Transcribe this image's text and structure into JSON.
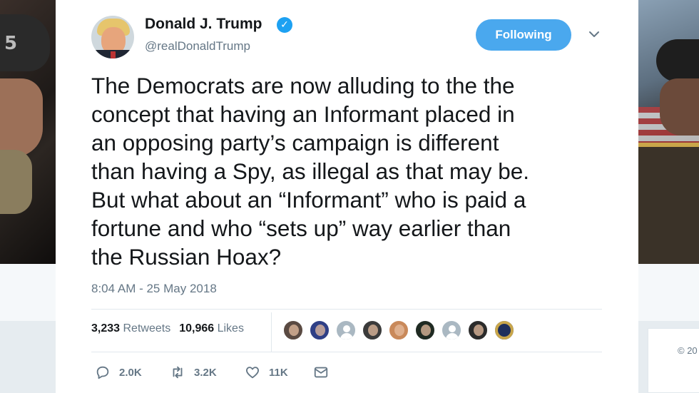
{
  "background": {
    "helmet_number": "5",
    "copyright_fragment": "© 20"
  },
  "tweet": {
    "author_name": "Donald J. Trump",
    "verified_mark": "✓",
    "handle": "@realDonaldTrump",
    "follow_button_label": "Following",
    "menu_icon": "chevron-down-icon",
    "text_lines": [
      "The Democrats are now alluding to the the",
      "concept that having an Informant placed in",
      "an opposing party’s campaign is different",
      "than having a Spy, as illegal as that may be.",
      "But what about an “Informant” who is paid a",
      "fortune and who “sets up” way earlier than",
      "the Russian Hoax?"
    ],
    "timestamp": "8:04 AM - 25 May 2018",
    "stats": {
      "retweets_count": "3,233",
      "retweets_label": "Retweets",
      "likes_count": "10,966",
      "likes_label": "Likes"
    },
    "liker_avatars": [
      {
        "icon": "user-avatar-1",
        "color": "#5a4a42"
      },
      {
        "icon": "user-avatar-2",
        "color": "#2f3f86"
      },
      {
        "icon": "default-avatar",
        "color": "#aab8c2"
      },
      {
        "icon": "user-avatar-4",
        "color": "#3b3b3b"
      },
      {
        "icon": "user-avatar-5",
        "color": "#c9895a"
      },
      {
        "icon": "user-avatar-6",
        "color": "#1f2a22"
      },
      {
        "icon": "default-avatar",
        "color": "#aab8c2"
      },
      {
        "icon": "user-avatar-8",
        "color": "#2b2b2b"
      },
      {
        "icon": "seal-avatar",
        "color": "#1e2f5c"
      }
    ],
    "actions": {
      "replies": "2.0K",
      "retweets": "3.2K",
      "likes": "11K"
    },
    "colors": {
      "accent": "#1da1f2",
      "follow_button": "#4aa8ee",
      "text": "#14171a",
      "secondary_text": "#657786"
    }
  }
}
